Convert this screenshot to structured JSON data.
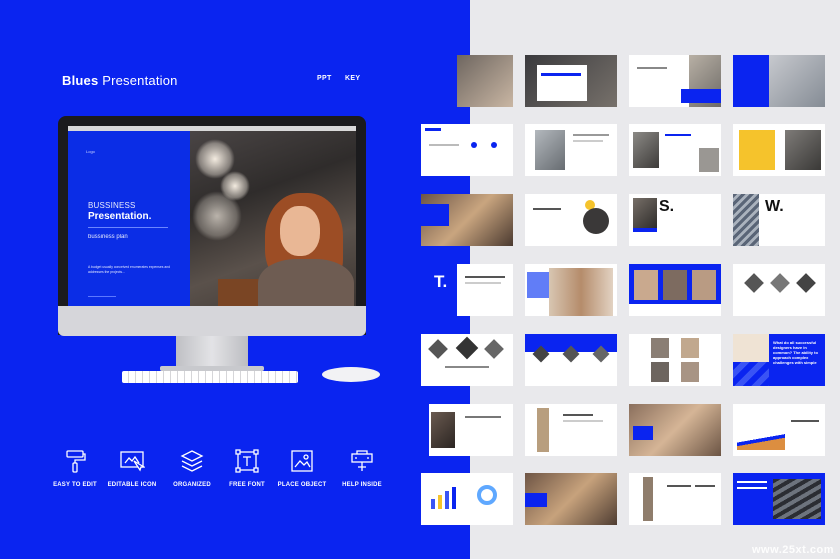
{
  "title": {
    "bold": "Blues",
    "rest": " Presentation"
  },
  "formats": [
    "PPT",
    "KEY"
  ],
  "screen": {
    "topbar": "Logo",
    "subtitle": "BUSSINESS",
    "main": "Presentation.",
    "plan": "bussiness plan",
    "body": "A budget usually conceived enumerates expenses and addresses the projects..."
  },
  "features": [
    {
      "label": "EASY TO EDIT",
      "icon": "paint-roller-icon"
    },
    {
      "label": "EDITABLE ICON",
      "icon": "pointer-icon"
    },
    {
      "label": "ORGANIZED",
      "icon": "layers-icon"
    },
    {
      "label": "FREE FONT",
      "icon": "font-icon"
    },
    {
      "label": "PLACE OBJECT",
      "icon": "image-icon"
    },
    {
      "label": "HELP INSIDE",
      "icon": "help-icon"
    }
  ],
  "slides_text": {
    "s_letter": "S.",
    "w_letter": "W.",
    "t_letter": "T.",
    "question": "What do all successful designers have in common? The ability to approach complex challenges with simple"
  },
  "colors": {
    "blue": "#0a24f0",
    "yellow": "#f5c32c",
    "light_gray": "#e9e9ec"
  },
  "watermark": "www.25xt.com"
}
